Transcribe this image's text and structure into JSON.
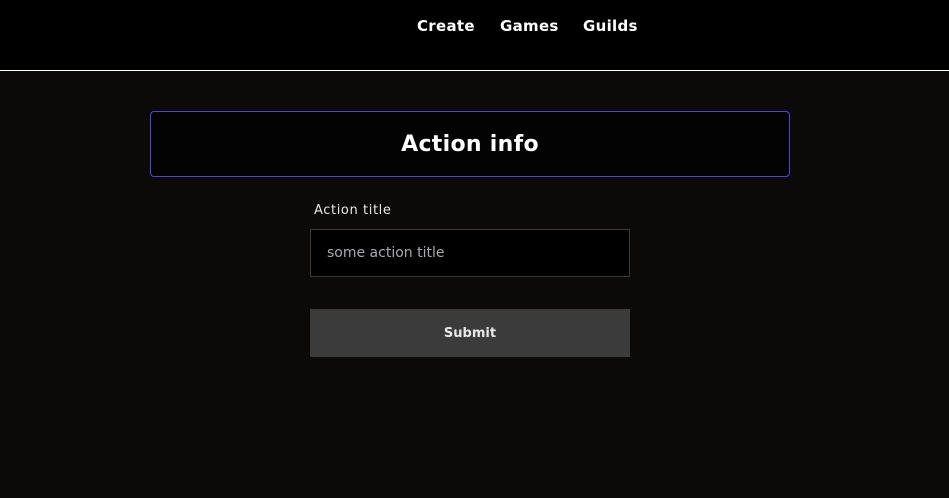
{
  "nav": {
    "create": "Create",
    "games": "Games",
    "guilds": "Guilds"
  },
  "card": {
    "title": "Action info"
  },
  "form": {
    "title_label": "Action title",
    "title_placeholder": "some action title",
    "title_value": "",
    "submit_label": "Submit"
  },
  "colors": {
    "page_background": "#0b0a09",
    "header_background": "#000000",
    "card_border_accent": "#4e46d8",
    "submit_background": "#3b3b3b"
  }
}
